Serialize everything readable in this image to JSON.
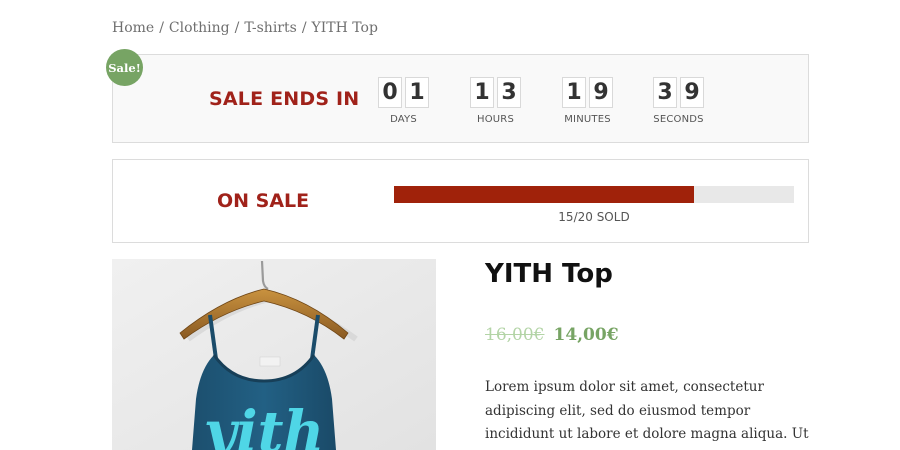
{
  "breadcrumb": {
    "items": [
      "Home",
      "Clothing",
      "T-shirts",
      "YITH Top"
    ],
    "separator": "/"
  },
  "countdown": {
    "badge": "Sale!",
    "title": "SALE ENDS IN",
    "units": [
      {
        "digits": [
          "0",
          "1"
        ],
        "label": "DAYS"
      },
      {
        "digits": [
          "1",
          "3"
        ],
        "label": "HOURS"
      },
      {
        "digits": [
          "1",
          "9"
        ],
        "label": "MINUTES"
      },
      {
        "digits": [
          "3",
          "9"
        ],
        "label": "SECONDS"
      }
    ]
  },
  "onsale": {
    "title": "ON SALE",
    "sold": 15,
    "total": 20,
    "sold_text": "15/20 SOLD"
  },
  "product": {
    "title": "YITH Top",
    "price_old": "16,00€",
    "price_new": "14,00€",
    "description": "Lorem ipsum dolor sit amet, consectetur adipiscing elit, sed do eiusmod tempor incididunt ut labore et dolore magna aliqua. Ut",
    "image_text": "yith"
  },
  "colors": {
    "accent_red": "#a0221a",
    "sale_green": "#77a464",
    "old_price": "#b3d4a6"
  }
}
